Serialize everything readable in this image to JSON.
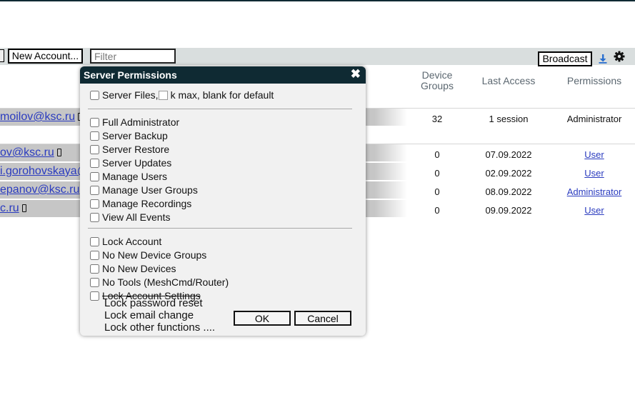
{
  "toolbar": {
    "new_account_label": "New Account...",
    "filter_placeholder": "Filter",
    "broadcast_label": "Broadcast",
    "download_icon": "download-icon",
    "settings_icon": "gear-icon"
  },
  "table": {
    "headers": {
      "device_groups": "Device Groups",
      "last_access": "Last Access",
      "permissions": "Permissions"
    },
    "rows": [
      {
        "email": "moilov@ksc.ru",
        "device_groups": "32",
        "last_access": "1 session",
        "permissions": "Administrator"
      },
      {
        "email": "ov@ksc.ru",
        "device_groups": "0",
        "last_access": "07.09.2022",
        "permissions": "User"
      },
      {
        "email": "i.gorohovskaya@",
        "device_groups": "0",
        "last_access": "02.09.2022",
        "permissions": "User"
      },
      {
        "email": "epanov@ksc.ru",
        "device_groups": "0",
        "last_access": "08.09.2022",
        "permissions": "Administrator"
      },
      {
        "email": "c.ru",
        "device_groups": "0",
        "last_access": "09.09.2022",
        "permissions": "User"
      }
    ]
  },
  "dialog": {
    "title": "Server Permissions",
    "close_glyph": "✖",
    "server_files_label": "Server Files,",
    "server_files_suffix": "k max, blank for default",
    "admin_options": [
      "Full Administrator",
      "Server Backup",
      "Server Restore",
      "Server Updates",
      "Manage Users",
      "Manage User Groups",
      "Manage Recordings",
      "View All Events"
    ],
    "lock_options": [
      "Lock Account",
      "No New Device Groups",
      "No New Devices",
      "No Tools (MeshCmd/Router)",
      "Lock Account Settings"
    ],
    "sub_options": [
      "Lock password reset",
      "Lock email change",
      "Lock other functions ...."
    ],
    "ok_label": "OK",
    "cancel_label": "Cancel"
  }
}
